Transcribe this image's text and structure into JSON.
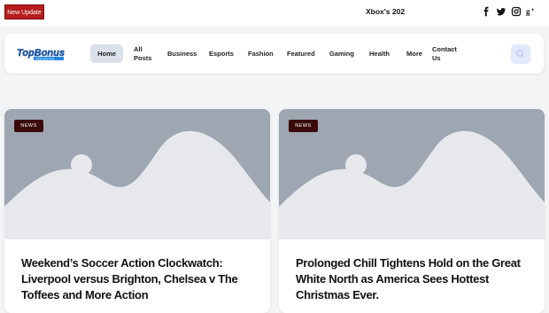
{
  "topbar": {
    "update_label": "New Update",
    "ticker_text": "Xbox's 202"
  },
  "social": {
    "facebook": "f",
    "twitter": "t",
    "instagram": "ig",
    "googleplus": "g+"
  },
  "nav": {
    "home": "Home",
    "all_posts": "All Posts",
    "business": "Business",
    "esports": "Esports",
    "fashion": "Fashion",
    "featured": "Featured",
    "gaming": "Gaming",
    "health": "Health",
    "more": "More",
    "contact": "Contact Us"
  },
  "logo": {
    "text": "TopBonus",
    "subtext": "WEB HOSTING"
  },
  "posts": [
    {
      "tag": "NEWS",
      "title": "Weekend’s Soccer Action Clockwatch: Liverpool versus Brighton, Chelsea v The Toffees and More Action"
    },
    {
      "tag": "NEWS",
      "title": "Prolonged Chill Tightens Hold on the Great White North as America Sees Hottest Christmas Ever."
    }
  ],
  "colors": {
    "accent": "#b71c1c",
    "image_placeholder": "#9ea6b1",
    "nav_active": "#dbe1ea"
  }
}
